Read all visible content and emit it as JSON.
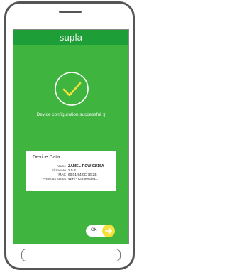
{
  "app": {
    "title": "supla"
  },
  "status": {
    "message": "Device configuration successful :)"
  },
  "device_data": {
    "title": "Device Data",
    "rows": [
      {
        "label": "Name",
        "value": "ZAMEL-ROW-01/16A"
      },
      {
        "label": "Firmware",
        "value": "2.5.3"
      },
      {
        "label": "MAC",
        "value": "60:01:94:0C:7E:2B"
      },
      {
        "label": "Previous status",
        "value": "WiFi - Connecting..."
      }
    ]
  },
  "actions": {
    "ok_label": "OK"
  },
  "colors": {
    "screen_bg": "#3fb53f",
    "topbar_bg": "#1e9e36",
    "check_color": "#f5e13a",
    "ring_color": "#ffffff",
    "accent_button": "#f5e13a"
  },
  "icons": {
    "success": "check-icon",
    "next": "arrow-right-icon"
  }
}
